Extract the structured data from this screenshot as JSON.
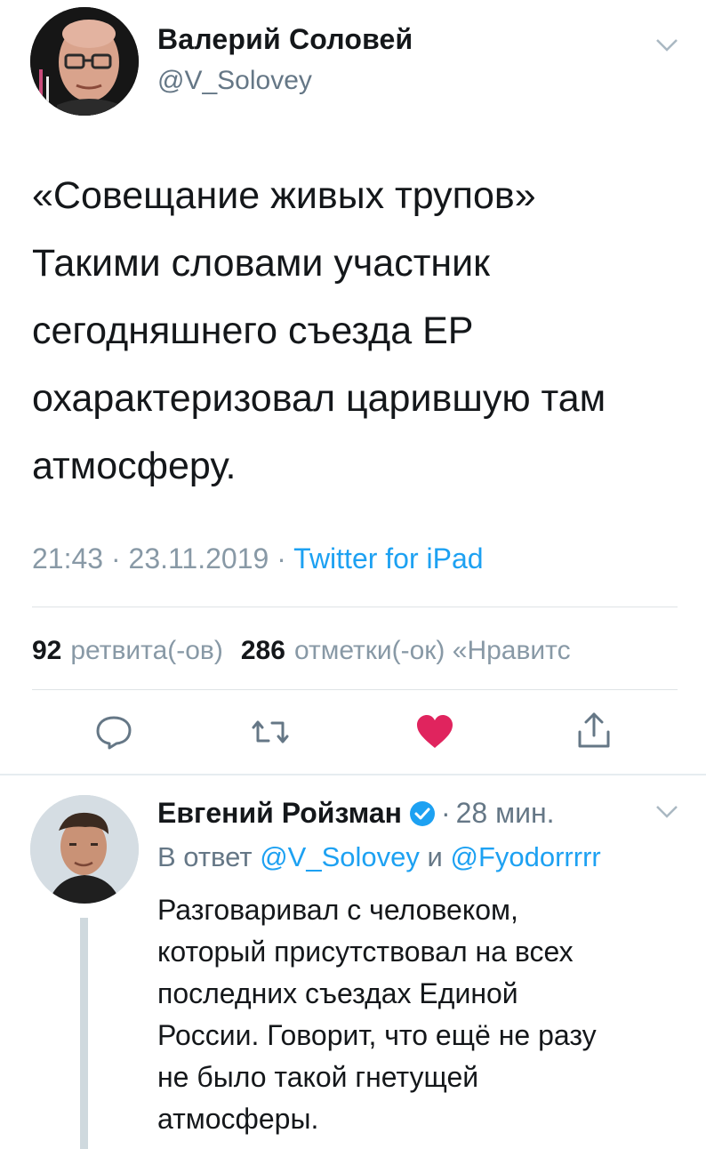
{
  "tweet": {
    "author": {
      "name": "Валерий Соловей",
      "handle": "@V_Solovey"
    },
    "text": "«Совещание живых трупов»\nТакими словами участник\nсегодняшнего съезда ЕР\nохарактеризовал царившую там\nатмосферу.",
    "time": "21:43",
    "date": "23.11.2019",
    "separator": "·",
    "source": "Twitter for iPad",
    "stats": {
      "retweets_count": "92",
      "retweets_label": "ретвита(-ов)",
      "likes_count": "286",
      "likes_label": "отметки(-ок) «Нравитс"
    },
    "actions": [
      {
        "icon": "reply-icon"
      },
      {
        "icon": "retweet-icon"
      },
      {
        "icon": "heart-filled-icon",
        "color": "#e0245e"
      },
      {
        "icon": "share-icon"
      }
    ]
  },
  "reply": {
    "author": {
      "name": "Евгений Ройзман",
      "verified": true
    },
    "separator": "·",
    "time_ago": "28 мин.",
    "reply_prefix": "В ответ",
    "mention_1": "@V_Solovey",
    "conjunction": "и",
    "mention_2": "@Fyodorrrrr",
    "text": "Разговаривал с человеком,\nкоторый присутствовал на всех\nпоследних съездах Единой\nРоссии. Говорит, что ещё не разу\nне было такой гнетущей\nатмосферы."
  },
  "colors": {
    "accent": "#1da1f2",
    "like": "#e0245e",
    "secondary_text": "#657786"
  }
}
